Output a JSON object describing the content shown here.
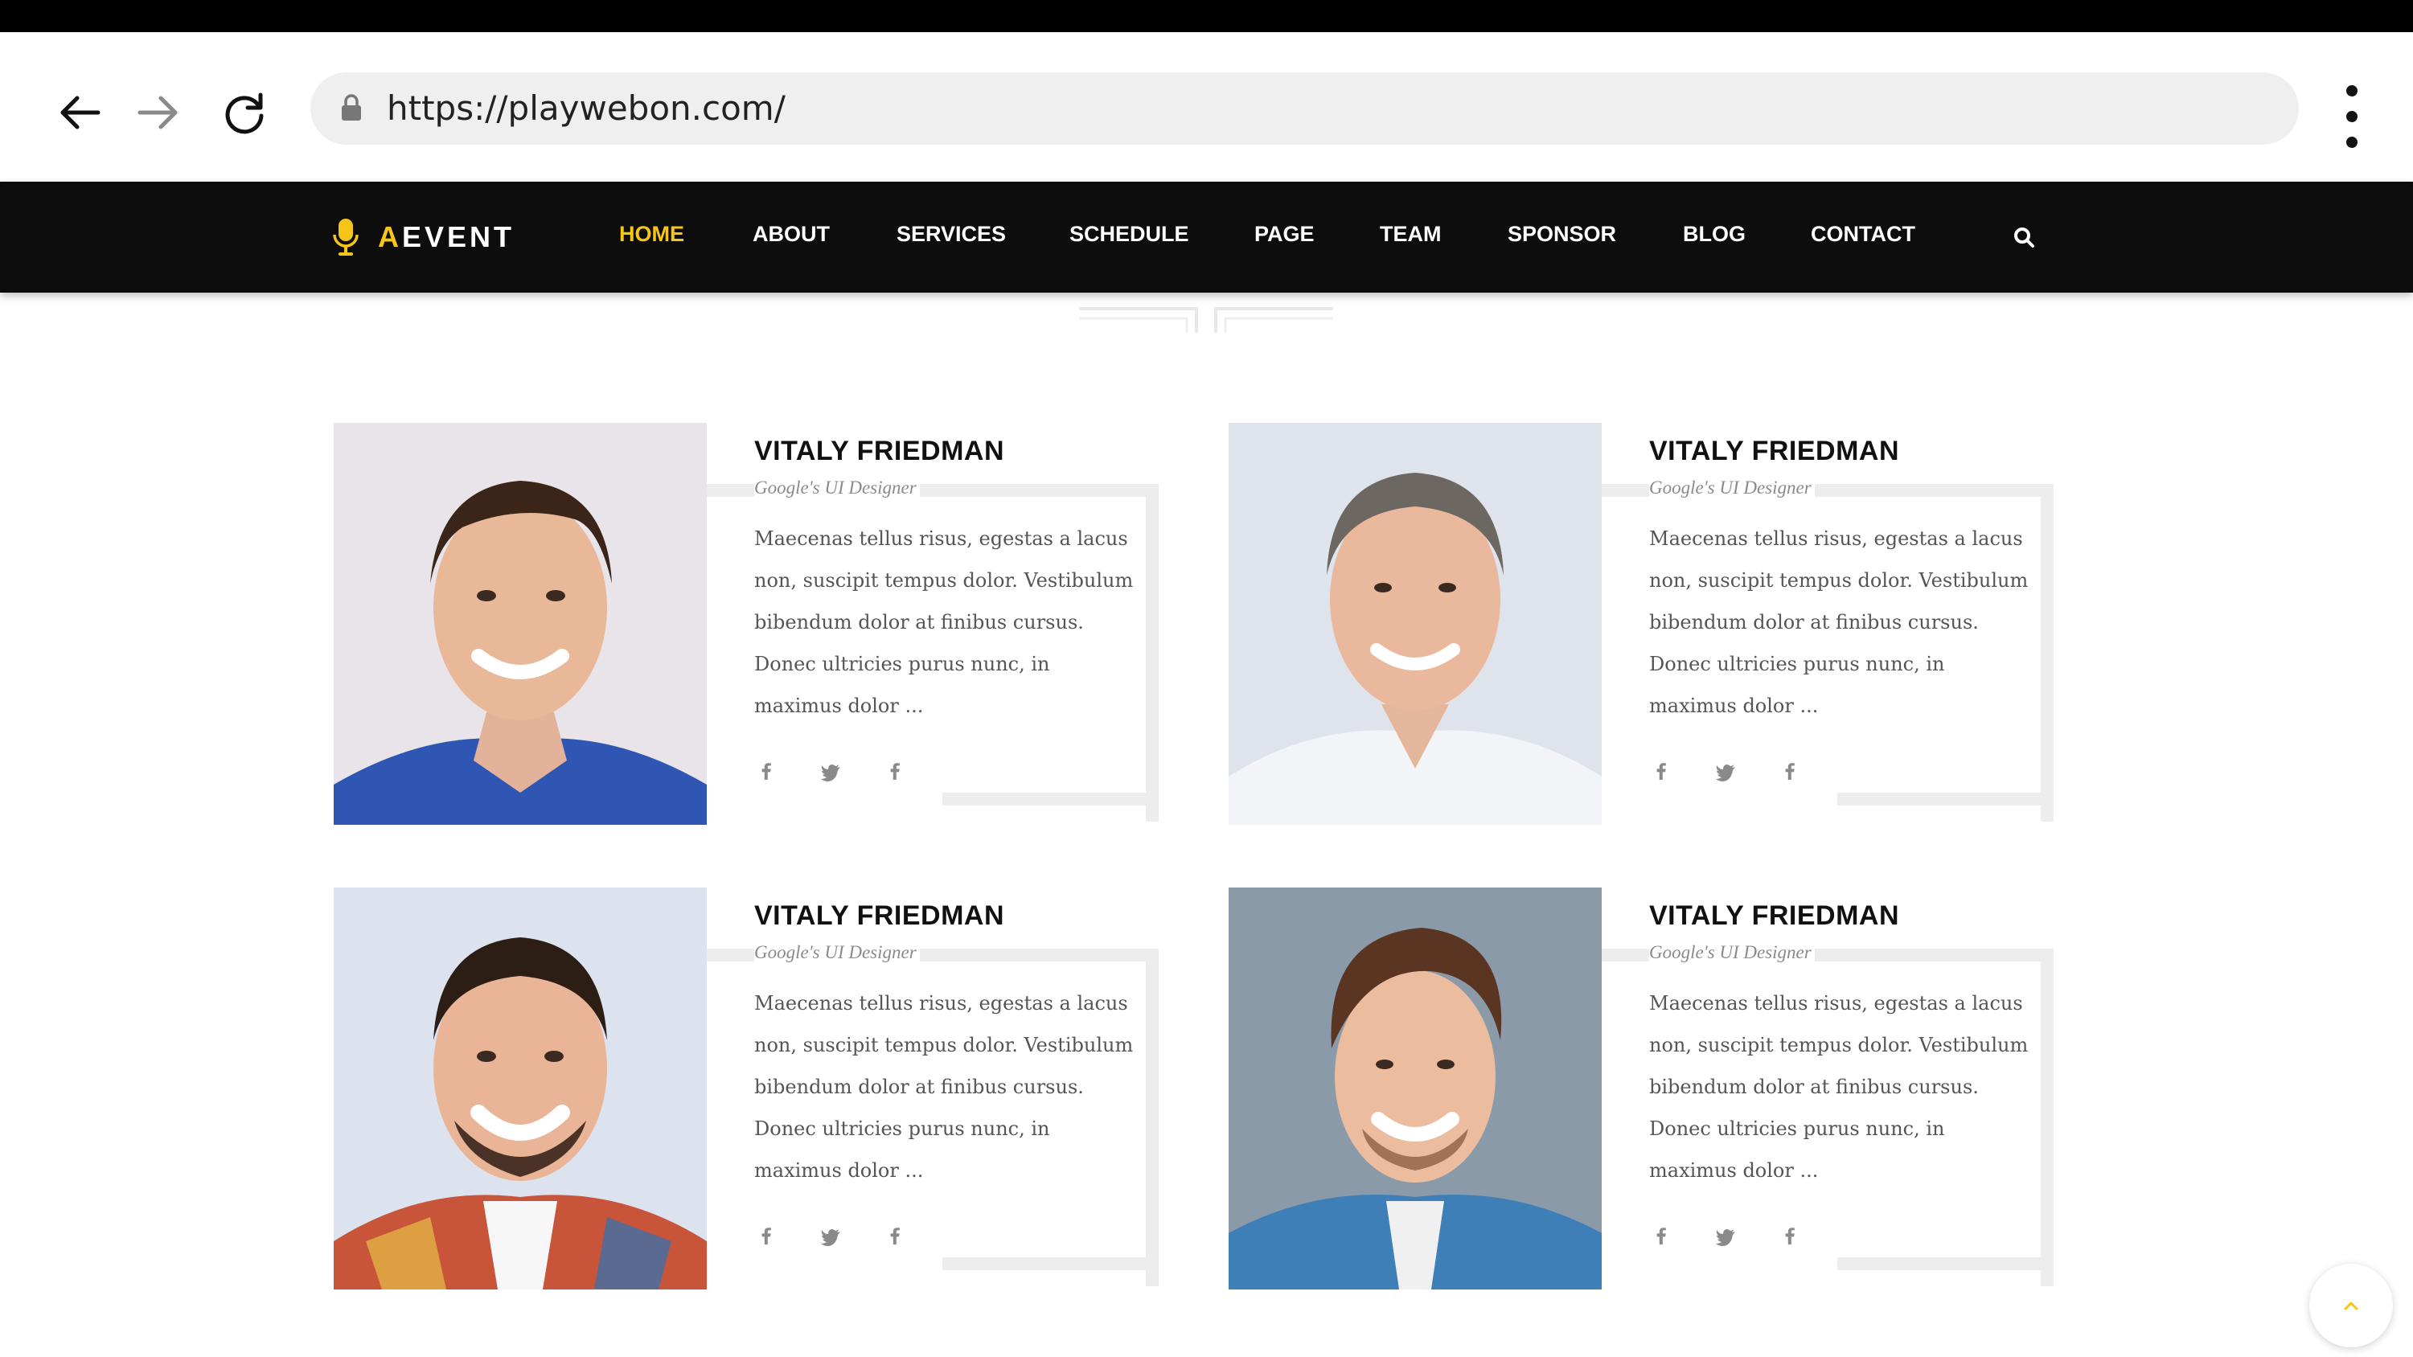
{
  "browser": {
    "url": "https://playwebon.com/",
    "icons": [
      "back-arrow-icon",
      "forward-arrow-icon",
      "reload-icon",
      "lock-icon",
      "more-vertical-icon"
    ]
  },
  "site": {
    "logo": {
      "letter": "A",
      "rest": "EVENT",
      "icon": "microphone-icon"
    },
    "menu": [
      {
        "label": "HOME",
        "active": true
      },
      {
        "label": "ABOUT",
        "active": false
      },
      {
        "label": "SERVICES",
        "active": false
      },
      {
        "label": "SCHEDULE",
        "active": false
      },
      {
        "label": "PAGE",
        "active": false
      },
      {
        "label": "TEAM",
        "active": false
      },
      {
        "label": "SPONSOR",
        "active": false
      },
      {
        "label": "BLOG",
        "active": false
      },
      {
        "label": "CONTACT",
        "active": false
      }
    ],
    "search_icon": "search-icon"
  },
  "colors": {
    "accent": "#f5c518",
    "nav_bg": "#0d0d0d",
    "frame": "#ededed",
    "text_dark": "#111111",
    "text_muted": "#8a8a8a"
  },
  "speakers": [
    {
      "name": "VITALY FRIEDMAN",
      "role": "Google's UI Designer",
      "bio": "Maecenas tellus risus, egestas a lacus non, suscipit tempus dolor. Vestibulum bibendum dolor at finibus cursus. Donec ultricies purus nunc, in maximus dolor ...",
      "social": [
        "facebook-icon",
        "twitter-icon",
        "facebook-icon"
      ]
    },
    {
      "name": "VITALY FRIEDMAN",
      "role": "Google's UI Designer",
      "bio": "Maecenas tellus risus, egestas a lacus non, suscipit tempus dolor. Vestibulum bibendum dolor at finibus cursus. Donec ultricies purus nunc, in maximus dolor ...",
      "social": [
        "facebook-icon",
        "twitter-icon",
        "facebook-icon"
      ]
    },
    {
      "name": "VITALY FRIEDMAN",
      "role": "Google's UI Designer",
      "bio": "Maecenas tellus risus, egestas a lacus non, suscipit tempus dolor. Vestibulum bibendum dolor at finibus cursus. Donec ultricies purus nunc, in maximus dolor ...",
      "social": [
        "facebook-icon",
        "twitter-icon",
        "facebook-icon"
      ]
    },
    {
      "name": "VITALY FRIEDMAN",
      "role": "Google's UI Designer",
      "bio": "Maecenas tellus risus, egestas a lacus non, suscipit tempus dolor. Vestibulum bibendum dolor at finibus cursus. Donec ultricies purus nunc, in maximus dolor ...",
      "social": [
        "facebook-icon",
        "twitter-icon",
        "facebook-icon"
      ]
    }
  ],
  "scroll_top_icon": "chevron-up-icon"
}
